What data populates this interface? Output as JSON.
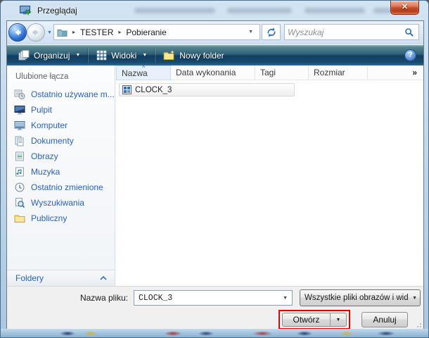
{
  "ui": {
    "caret": "▼",
    "crumb_separator": "▸",
    "overflow_glyph": "»",
    "close_glyph": "✕",
    "help_glyph": "?",
    "sort_indicator": "^"
  },
  "window": {
    "title": "Przeglądaj"
  },
  "navbar": {
    "breadcrumb": [
      "TESTER",
      "Pobieranie"
    ],
    "search_placeholder": "Wyszukaj"
  },
  "toolbar": {
    "organize_label": "Organizuj",
    "views_label": "Widoki",
    "new_folder_label": "Nowy folder"
  },
  "sidebar": {
    "header": "Ulubione łącza",
    "items": [
      "Ostatnio używane m...",
      "Pulpit",
      "Komputer",
      "Dokumenty",
      "Obrazy",
      "Muzyka",
      "Ostatnio zmienione",
      "Wyszukiwania",
      "Publiczny"
    ],
    "folders_label": "Foldery"
  },
  "content": {
    "columns": [
      "Nazwa",
      "Data wykonania",
      "Tagi",
      "Rozmiar"
    ],
    "files": [
      {
        "name": "CLOCK_3"
      }
    ]
  },
  "footer": {
    "filename_label": "Nazwa pliku:",
    "filename_value": "CLOCK_3",
    "filetype_value": "Wszystkie pliki obrazów i wid",
    "open_label": "Otwórz",
    "cancel_label": "Anuluj"
  },
  "colors": {
    "annotation_red": "#e60000",
    "close_button_red": "#c04a28",
    "link_blue": "#2a62b9",
    "toolbar_navy": "#123e60"
  }
}
